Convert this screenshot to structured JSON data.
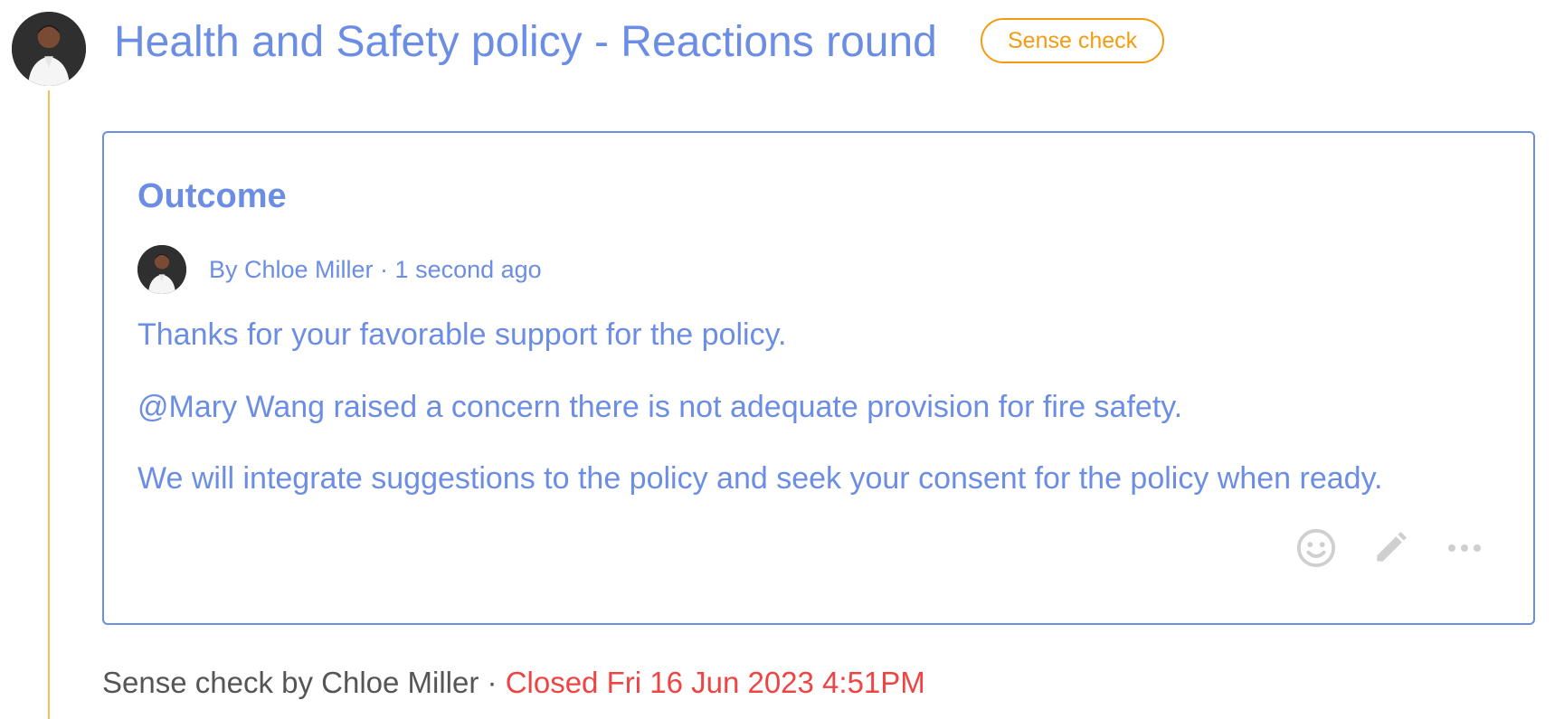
{
  "post": {
    "title": "Health and Safety policy - Reactions round",
    "badge": "Sense check",
    "avatar": "user-avatar"
  },
  "outcome": {
    "heading": "Outcome",
    "byline": "By Chloe Miller · 1 second ago",
    "paragraphs": [
      "Thanks for your favorable support for the policy.",
      "@Mary Wang raised a concern there is not adequate provision for fire safety.",
      "We will integrate suggestions to the policy and seek your consent for the policy when ready."
    ],
    "actions": {
      "react": "emoji-icon",
      "edit": "pencil-icon",
      "more": "more-horizontal-icon"
    }
  },
  "footer": {
    "meta": "Sense check by Chloe Miller · ",
    "status": "Closed Fri 16 Jun 2023 4:51PM"
  },
  "colors": {
    "accent": "#6b8de3",
    "badge": "#f39c12",
    "thread_line": "#f2c14e",
    "closed": "#ef4444",
    "muted_text": "#555555",
    "icon_gray": "#cfcfcf"
  }
}
